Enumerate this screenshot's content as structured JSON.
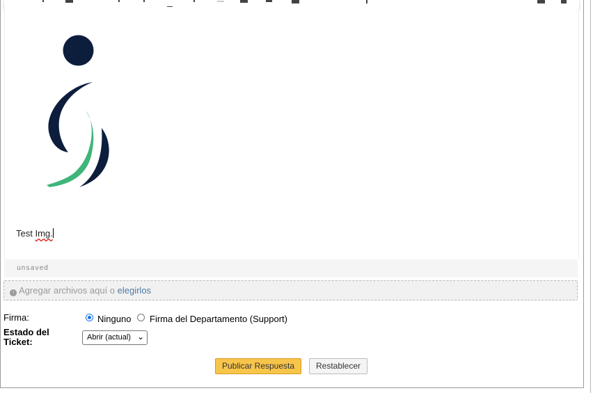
{
  "editor": {
    "body_prefix": "Test ",
    "body_misspelled": "Img.",
    "status": "unsaved"
  },
  "dropzone": {
    "icon": "upload-circle-icon",
    "text": "Agregar archivos aquí o ",
    "link": "elegirlos"
  },
  "signature": {
    "label": "Firma:",
    "options": [
      {
        "label": "Ninguno",
        "selected": true
      },
      {
        "label": "Firma del Departamento (Support)",
        "selected": false
      }
    ]
  },
  "ticket_status": {
    "label": "Estado del Ticket:",
    "selected": "Abrir (actual)"
  },
  "buttons": {
    "post": "Publicar Respuesta",
    "reset": "Restablecer"
  },
  "colors": {
    "logo_navy": "#0d1e3d",
    "logo_green": "#3fb57a",
    "primary_button": "#f8c54b",
    "link": "#4d7aa6"
  }
}
